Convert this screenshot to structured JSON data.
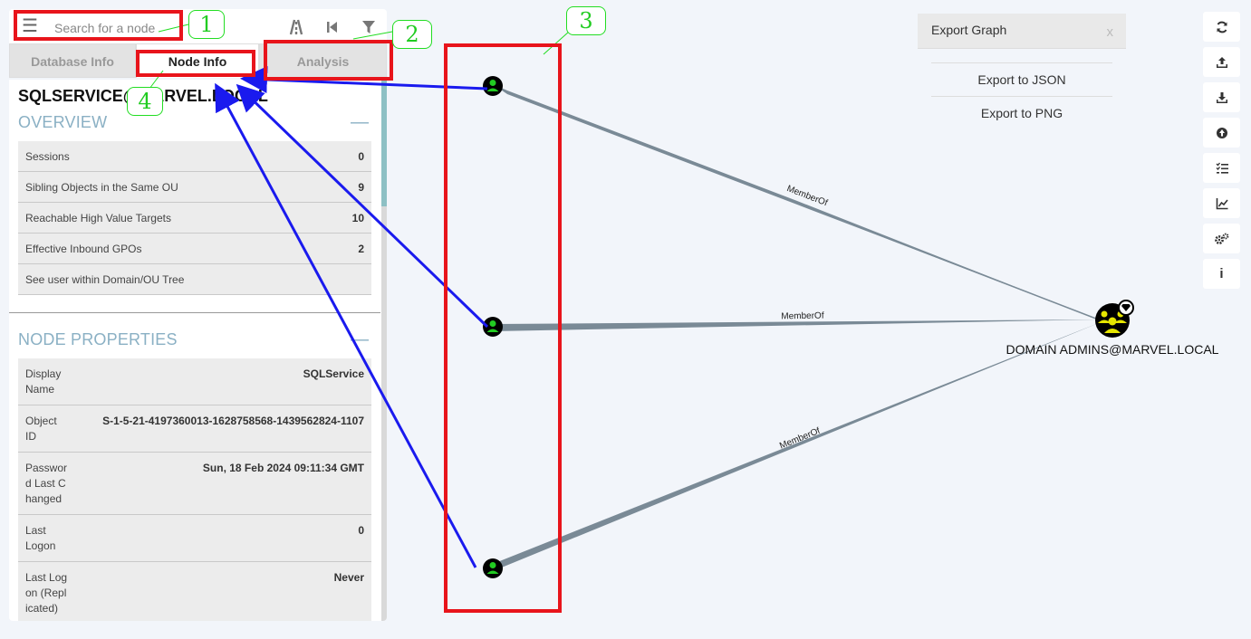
{
  "search": {
    "placeholder": "Search for a node"
  },
  "tabs": {
    "database_info": "Database Info",
    "node_info": "Node Info",
    "analysis": "Analysis"
  },
  "node": {
    "title": "SQLSERVICE@MARVEL.LOCAL"
  },
  "overview": {
    "title": "OVERVIEW",
    "rows": [
      {
        "label": "Sessions",
        "value": "0"
      },
      {
        "label": "Sibling Objects in the Same OU",
        "value": "9"
      },
      {
        "label": "Reachable High Value Targets",
        "value": "10"
      },
      {
        "label": "Effective Inbound GPOs",
        "value": "2"
      },
      {
        "label": "See user within Domain/OU Tree",
        "value": ""
      }
    ]
  },
  "node_properties": {
    "title": "NODE PROPERTIES",
    "rows": [
      {
        "label": "Display Name",
        "value": "SQLService"
      },
      {
        "label": "Object ID",
        "value": "S-1-5-21-4197360013-1628758568-1439562824-1107"
      },
      {
        "label": "Password Last Changed",
        "value": "Sun, 18 Feb 2024 09:11:34 GMT"
      },
      {
        "label": "Last Logon",
        "value": "0"
      },
      {
        "label": "Last Logon (Replicated)",
        "value": "Never"
      }
    ]
  },
  "graph": {
    "edge_label": "MemberOf",
    "group_label": "DOMAIN ADMINS@MARVEL.LOCAL"
  },
  "export": {
    "title": "Export Graph",
    "close": "x",
    "items": [
      "Export to JSON",
      "Export to PNG"
    ]
  },
  "toolbar": {
    "icons": [
      "refresh-icon",
      "upload-icon",
      "download-icon",
      "import-icon",
      "queries-icon",
      "stats-icon",
      "settings-icon",
      "info-icon"
    ]
  },
  "annotations": {
    "labels": [
      "1",
      "2",
      "3",
      "4"
    ],
    "color": "#e8141b",
    "arrow_color": "#1a1aee"
  },
  "colors": {
    "user_node": "#22cc22",
    "group_node": "#e6e600",
    "edge": "#7a8a96",
    "section": "#8ab0c4"
  }
}
